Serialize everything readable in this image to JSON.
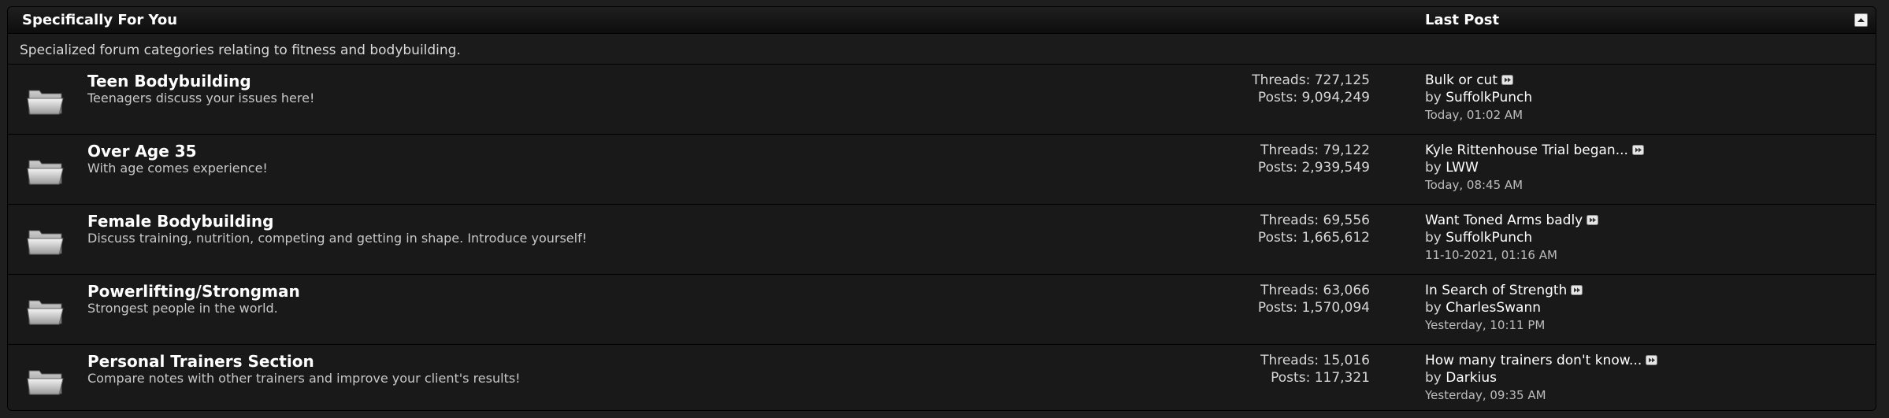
{
  "category": {
    "title": "Specifically For You",
    "last_post_heading": "Last Post",
    "description": "Specialized forum categories relating to fitness and bodybuilding."
  },
  "icons": {
    "folder": "folder-icon",
    "goto_last_post": "goto-last-post-icon",
    "collapse": "collapse-icon"
  },
  "forums": [
    {
      "title": "Teen Bodybuilding",
      "description": "Teenagers discuss your issues here!",
      "threads": "Threads: 727,125",
      "posts": "Posts: 9,094,249",
      "last_post": {
        "title": "Bulk or cut",
        "by": "by",
        "user": "SuffolkPunch",
        "time": "Today, 01:02 AM"
      }
    },
    {
      "title": "Over Age 35",
      "description": "With age comes experience!",
      "threads": "Threads: 79,122",
      "posts": "Posts: 2,939,549",
      "last_post": {
        "title": "Kyle Rittenhouse Trial began...",
        "by": "by",
        "user": "LWW",
        "time": "Today, 08:45 AM"
      }
    },
    {
      "title": "Female Bodybuilding",
      "description": "Discuss training, nutrition, competing and getting in shape. Introduce yourself!",
      "threads": "Threads: 69,556",
      "posts": "Posts: 1,665,612",
      "last_post": {
        "title": "Want Toned Arms badly",
        "by": "by",
        "user": "SuffolkPunch",
        "time": "11-10-2021, 01:16 AM"
      }
    },
    {
      "title": "Powerlifting/Strongman",
      "description": "Strongest people in the world.",
      "threads": "Threads: 63,066",
      "posts": "Posts: 1,570,094",
      "last_post": {
        "title": "In Search of Strength",
        "by": "by",
        "user": "CharlesSwann",
        "time": "Yesterday, 10:11 PM"
      }
    },
    {
      "title": "Personal Trainers Section",
      "description": "Compare notes with other trainers and improve your client's results!",
      "threads": "Threads: 15,016",
      "posts": "Posts: 117,321",
      "last_post": {
        "title": "How many trainers don't know...",
        "by": "by",
        "user": "Darkius",
        "time": "Yesterday, 09:35 AM"
      }
    }
  ]
}
